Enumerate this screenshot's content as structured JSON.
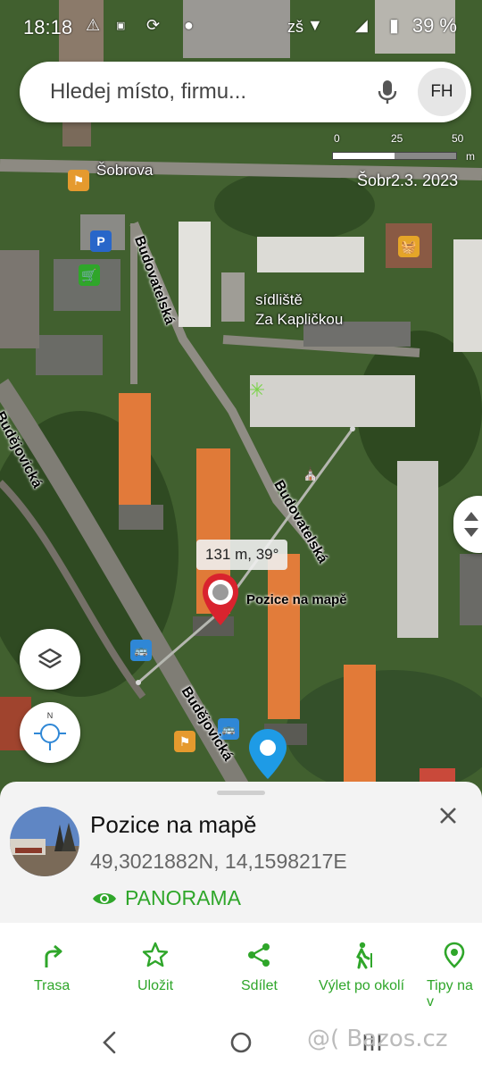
{
  "status_bar": {
    "time": "18:18",
    "carrier_text": "zš",
    "battery": "39 %"
  },
  "search": {
    "placeholder": "Hledej místo, firmu...",
    "avatar_initials": "FH"
  },
  "scale": {
    "labels": [
      "0",
      "25",
      "50"
    ],
    "unit": "m"
  },
  "attribution": "Šobr2.3. 2023",
  "map_labels": {
    "sobrova": "Šobrova",
    "budovatelska_1": "Budovatelská",
    "budovatelska_2": "Budovatelská",
    "budejovicka_1": "Budějovická",
    "budejovicka_2": "Budějovická",
    "sidliste_line1": "sídliště",
    "sidliste_line2": "Za Kapličkou"
  },
  "measurement": "131 m, 39°",
  "marker_label": "Pozice na mapě",
  "detail": {
    "title": "Pozice na mapě",
    "coordinates": "49,3021882N, 14,1598217E",
    "panorama_label": "PANORAMA"
  },
  "actions": [
    {
      "label": "Trasa",
      "icon": "route-icon"
    },
    {
      "label": "Uložit",
      "icon": "star-icon"
    },
    {
      "label": "Sdílet",
      "icon": "share-icon"
    },
    {
      "label": "Výlet po okolí",
      "icon": "hiking-icon"
    },
    {
      "label": "Tipy na v",
      "icon": "location-pin-icon"
    }
  ],
  "watermark": "@( Bazos.cz",
  "colors": {
    "accent_green": "#2fa62a",
    "marker_red": "#d9232e",
    "location_blue": "#1e9be6"
  }
}
